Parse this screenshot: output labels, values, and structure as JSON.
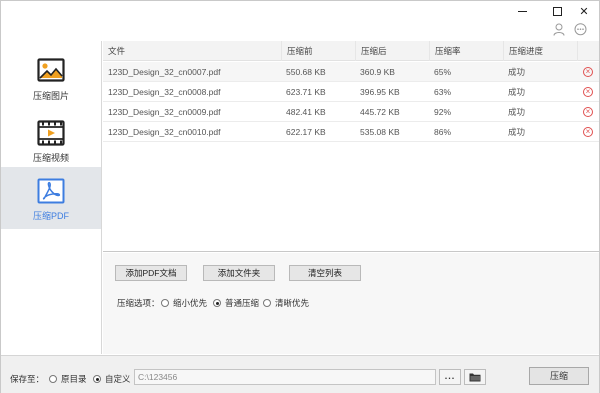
{
  "window": {
    "controls": {
      "minimize": "minimize",
      "maximize": "maximize",
      "close": "✕"
    }
  },
  "sidebar": {
    "items": [
      {
        "label": "压缩图片",
        "icon": "image-icon",
        "active": false
      },
      {
        "label": "压缩视频",
        "icon": "video-icon",
        "active": false
      },
      {
        "label": "压缩PDF",
        "icon": "pdf-icon",
        "active": true
      }
    ]
  },
  "table": {
    "headers": [
      "文件",
      "压缩前",
      "压缩后",
      "压缩率",
      "压缩进度"
    ],
    "rows": [
      {
        "name": "123D_Design_32_cn0007.pdf",
        "before": "550.68 KB",
        "after": "360.9 KB",
        "rate": "65%",
        "status": "成功"
      },
      {
        "name": "123D_Design_32_cn0008.pdf",
        "before": "623.71 KB",
        "after": "396.95 KB",
        "rate": "63%",
        "status": "成功"
      },
      {
        "name": "123D_Design_32_cn0009.pdf",
        "before": "482.41 KB",
        "after": "445.72 KB",
        "rate": "92%",
        "status": "成功"
      },
      {
        "name": "123D_Design_32_cn0010.pdf",
        "before": "622.17 KB",
        "after": "535.08 KB",
        "rate": "86%",
        "status": "成功"
      }
    ]
  },
  "actions": {
    "add_pdf": "添加PDF文档",
    "add_folder": "添加文件夹",
    "clear_list": "清空列表",
    "options_label": "压缩选项：",
    "options": [
      {
        "label": "缩小优先",
        "selected": false
      },
      {
        "label": "普通压缩",
        "selected": true
      },
      {
        "label": "清晰优先",
        "selected": false
      }
    ]
  },
  "footer": {
    "save_label": "保存至：",
    "save_options": [
      {
        "label": "原目录",
        "selected": false
      },
      {
        "label": "自定义",
        "selected": true
      }
    ],
    "path_value": "C:\\123456",
    "browse_label": "...",
    "compress_label": "压缩"
  },
  "colors": {
    "accent": "#3d7de0",
    "delete": "#e05050",
    "active_bg": "#e3e6ea"
  }
}
